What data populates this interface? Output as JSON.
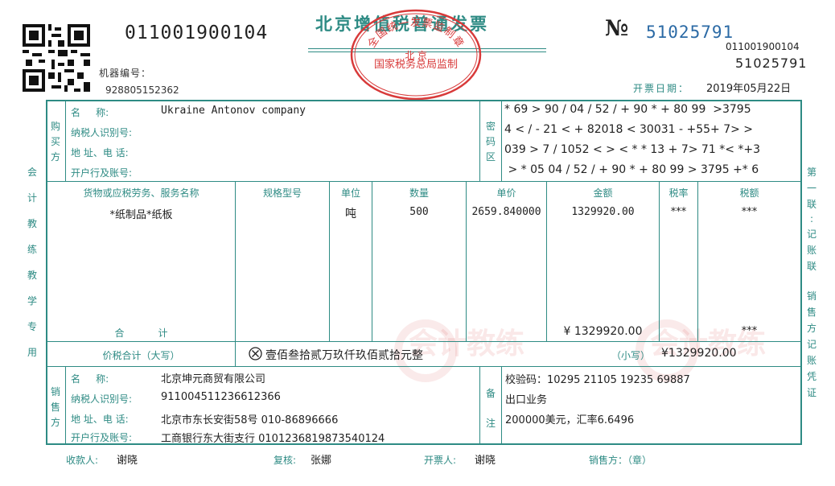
{
  "header": {
    "invoice_code": "011001900104",
    "title": "北京增值税普通发票",
    "no_symbol": "№",
    "invoice_no": "51025791",
    "code_right": "011001900104",
    "no_right": "51025791",
    "machine_label": "机器编号：",
    "machine_no": "928805152362",
    "date_label": "开票日期：",
    "date": "2019年05月22日"
  },
  "seal": {
    "top_text": "全国统一发票监制章",
    "middle_text": "北  京",
    "bottom_text": "国家税务总局监制",
    "color": "#d83a3a"
  },
  "side": {
    "left": [
      "会",
      "计",
      "教",
      "练",
      "教",
      "学",
      "专",
      "用"
    ],
    "right": [
      "第",
      "一",
      "联",
      ":",
      "记",
      "账",
      "联",
      "",
      "销",
      "售",
      "方",
      "记",
      "账",
      "凭",
      "证"
    ]
  },
  "buyer": {
    "section_label": [
      "购",
      "买",
      "方"
    ],
    "name_label": "名     称:",
    "taxid_label": "纳税人识别号:",
    "address_label": "地 址、电 话:",
    "bank_label": "开户行及账号:",
    "name": "Ukraine Antonov company",
    "taxid": "",
    "address": "",
    "bank": ""
  },
  "cipher": {
    "label": [
      "密",
      "码",
      "区"
    ],
    "lines": [
      "* 69 > 90 / 04 / 52 / + 90 * + 80 99  >3795",
      "4 < / - 21 < + 82018 < 30031 - +55+ 7> >",
      "039 > 7 / 1052 < > < * * 13 + 7> 71 *< *+3",
      " > * 05 04 / 52 / + 90 * + 80 99 > 3795 +* 6"
    ]
  },
  "items": {
    "headers": [
      "货物或应税劳务、服务名称",
      "规格型号",
      "单位",
      "数量",
      "单价",
      "金额",
      "税率",
      "税额"
    ],
    "row": {
      "name": "*纸制品*纸板",
      "spec": "",
      "unit": "吨",
      "quantity": "500",
      "unit_price": "2659.840000",
      "amount": "1329920.00",
      "tax_rate": "***",
      "tax": "***"
    },
    "total_label": "合           计",
    "total_amount": "¥ 1329920.00",
    "total_tax": "***"
  },
  "grand_total": {
    "label": "价税合计（大写）",
    "icon": "circle-x-icon",
    "uppercase": "壹佰叁拾贰万玖仟玖佰贰拾元整",
    "small_label": "（小写）",
    "small_value": "¥1329920.00"
  },
  "seller": {
    "section_label": [
      "销",
      "售",
      "方"
    ],
    "name_label": "名     称:",
    "taxid_label": "纳税人识别号:",
    "address_label": "地 址、电 话:",
    "bank_label": "开户行及账号:",
    "name": "北京坤元商贸有限公司",
    "taxid": "911004511236612366",
    "address": "北京市东长安街58号 010-86896666",
    "bank": "工商银行东大街支行 0101236819873540124"
  },
  "remarks": {
    "label": [
      "备",
      "注"
    ],
    "lines": [
      "校验码：10295 21105 19235 69887",
      "出口业务",
      "200000美元，汇率6.6496"
    ]
  },
  "footer": {
    "payee_label": "收款人:",
    "payee": "谢晓",
    "reviewer_label": "复核:",
    "reviewer": "张娜",
    "issuer_label": "开票人:",
    "issuer": "谢晓",
    "seller_label": "销售方：（章）"
  },
  "watermark": [
    "会计教练",
    "会计教练"
  ]
}
